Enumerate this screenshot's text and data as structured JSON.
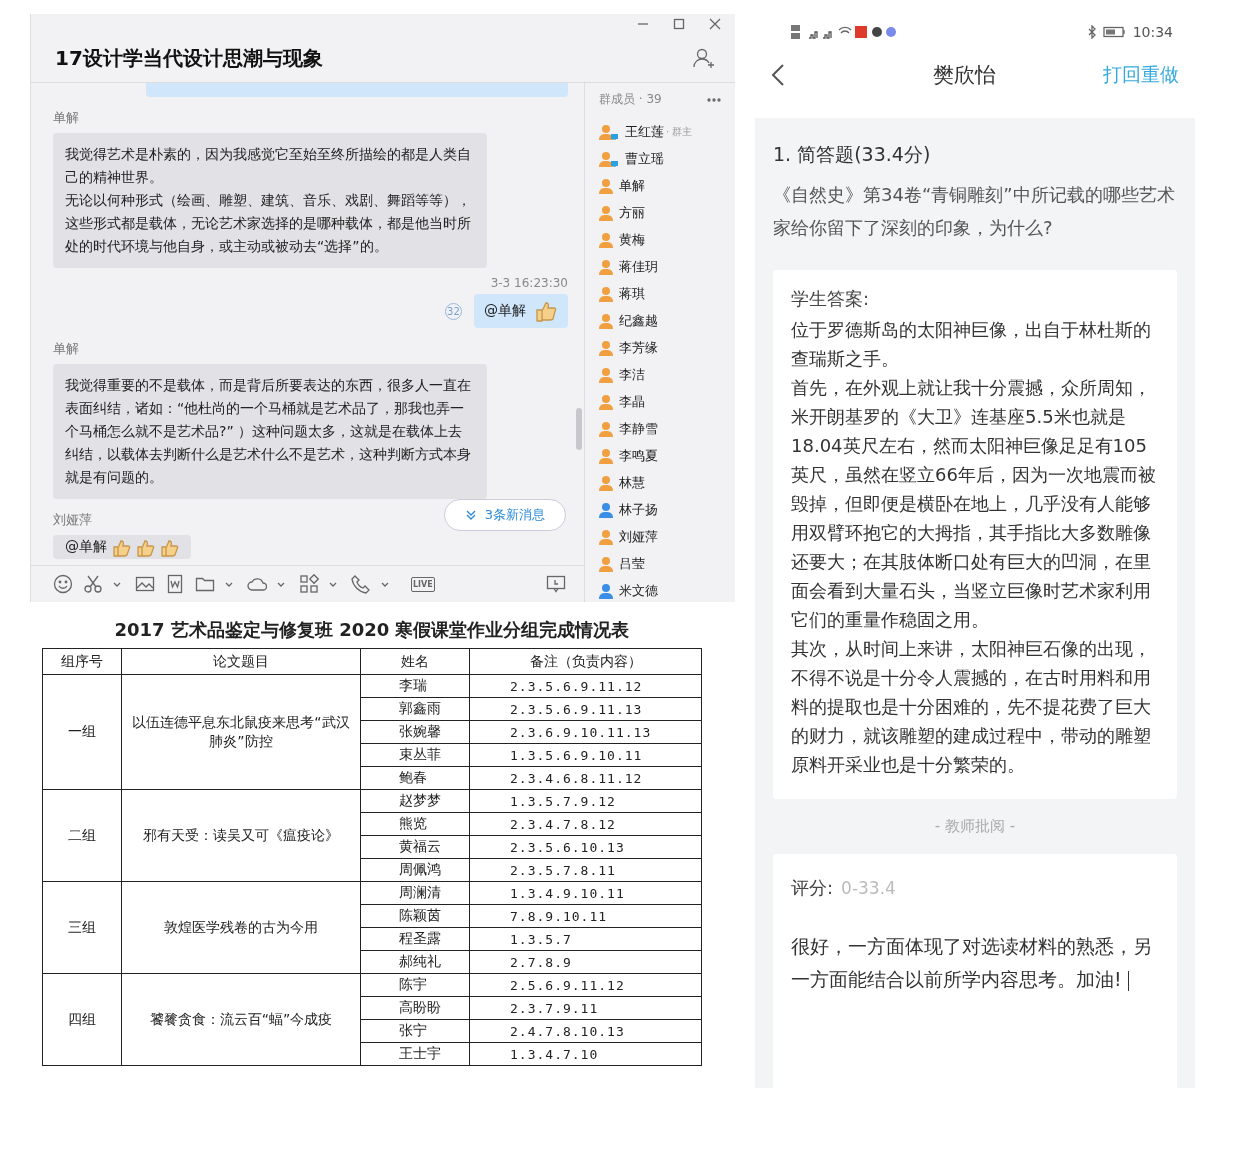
{
  "chat_window": {
    "title": "17设计学当代设计思潮与现象",
    "messages": [
      {
        "kind": "cut"
      },
      {
        "kind": "incoming",
        "sender": "单解",
        "paragraphs": [
          "我觉得艺术是朴素的，因为我感觉它至始至终所描绘的都是人类自己的精神世界。",
          "无论以何种形式（绘画、雕塑、建筑、音乐、戏剧、舞蹈等等），这些形式都是载体，无论艺术家选择的是哪种载体，都是他当时所处的时代环境与他自身，或主动或被动去“选择”的。"
        ]
      },
      {
        "kind": "outgoing",
        "time": "3-3 16:23:30",
        "read_count": "32",
        "text": "@单解"
      },
      {
        "kind": "incoming",
        "sender": "单解",
        "paragraphs": [
          "我觉得重要的不是载体，而是背后所要表达的东西，很多人一直在表面纠结，诸如：“他杜尚的一个马桶就是艺术品了，那我也弄一个马桶怎么就不是艺术品?” ）这种问题太多，这就是在载体上去纠结，以载体去判断什么是艺术什么不是艺术，这种判断方式本身就是有问题的。"
        ]
      },
      {
        "kind": "partial",
        "sender": "刘娅萍",
        "text": "@单解"
      }
    ],
    "new_messages": "3条新消息",
    "live_label": "LIVE",
    "members_header": "群成员 · 39",
    "members": [
      {
        "name": "王红莲",
        "role": "· 群主",
        "kind": "pc",
        "color": "#f0a040"
      },
      {
        "name": "曹立瑶",
        "kind": "pc",
        "color": "#f0a040"
      },
      {
        "name": "单解",
        "kind": "plain",
        "color": "#f0a040"
      },
      {
        "name": "方丽",
        "kind": "plain",
        "color": "#f0a040"
      },
      {
        "name": "黄梅",
        "kind": "plain",
        "color": "#f0a040"
      },
      {
        "name": "蒋佳玥",
        "kind": "plain",
        "color": "#f0a040"
      },
      {
        "name": "蒋琪",
        "kind": "plain",
        "color": "#f0a040"
      },
      {
        "name": "纪鑫越",
        "kind": "plain",
        "color": "#f0a040"
      },
      {
        "name": "李芳缘",
        "kind": "plain",
        "color": "#f0a040"
      },
      {
        "name": "李洁",
        "kind": "plain",
        "color": "#f0a040"
      },
      {
        "name": "李晶",
        "kind": "plain",
        "color": "#f0a040"
      },
      {
        "name": "李静雪",
        "kind": "plain",
        "color": "#f0a040"
      },
      {
        "name": "李鸣夏",
        "kind": "plain",
        "color": "#f0a040"
      },
      {
        "name": "林慧",
        "kind": "plain",
        "color": "#f0a040"
      },
      {
        "name": "林子扬",
        "kind": "plain",
        "color": "#3a8ee6"
      },
      {
        "name": "刘娅萍",
        "kind": "plain",
        "color": "#f0a040"
      },
      {
        "name": "吕莹",
        "kind": "plain",
        "color": "#f0a040"
      },
      {
        "name": "米文德",
        "kind": "plain",
        "color": "#3a8ee6"
      }
    ]
  },
  "table": {
    "title": "2017 艺术品鉴定与修复班 2020 寒假课堂作业分组完成情况表",
    "columns": [
      "组序号",
      "论文题目",
      "姓名",
      "备注（负责内容）"
    ],
    "groups": [
      {
        "label": "一组",
        "topic": "以伍连德平息东北鼠疫来思考“武汉肺炎”防控",
        "members": [
          {
            "name": "李瑞",
            "notes": "2.3.5.6.9.11.12"
          },
          {
            "name": "郭鑫雨",
            "notes": "2.3.5.6.9.11.13"
          },
          {
            "name": "张婉馨",
            "notes": "2.3.6.9.10.11.13"
          },
          {
            "name": "束丛菲",
            "notes": "1.3.5.6.9.10.11"
          },
          {
            "name": "鲍春",
            "notes": "2.3.4.6.8.11.12"
          }
        ]
      },
      {
        "label": "二组",
        "topic": "邪有天受：读吴又可《瘟疫论》",
        "members": [
          {
            "name": "赵梦梦",
            "notes": "1.3.5.7.9.12"
          },
          {
            "name": "熊览",
            "notes": "2.3.4.7.8.12"
          },
          {
            "name": "黄福云",
            "notes": "2.3.5.6.10.13"
          },
          {
            "name": "周佩鸿",
            "notes": "2.3.5.7.8.11"
          }
        ]
      },
      {
        "label": "三组",
        "topic": "敦煌医学残卷的古为今用",
        "members": [
          {
            "name": "周澜清",
            "notes": "1.3.4.9.10.11"
          },
          {
            "name": "陈颖茵",
            "notes": "7.8.9.10.11"
          },
          {
            "name": "程圣露",
            "notes": "1.3.5.7"
          },
          {
            "name": "郝纯礼",
            "notes": "2.7.8.9"
          }
        ]
      },
      {
        "label": "四组",
        "topic": "饕餮贪食：流云百“蝠”今成疫",
        "members": [
          {
            "name": "陈宇",
            "notes": "2.5.6.9.11.12"
          },
          {
            "name": "高盼盼",
            "notes": "2.3.7.9.11"
          },
          {
            "name": "张宁",
            "notes": "2.4.7.8.10.13"
          },
          {
            "name": "王士宇",
            "notes": "1.3.4.7.10"
          }
        ]
      }
    ]
  },
  "phone": {
    "time": "10:34",
    "title": "樊欣怡",
    "action": "打回重做",
    "question_heading": "1. 简答题(33.4分)",
    "question": "《自然史》第34卷“青铜雕刻”中所记载的哪些艺术家给你留下了深刻的印象，为什么?",
    "answer_label": "学生答案:",
    "answer": [
      "位于罗德斯岛的太阳神巨像，出自于林杜斯的查瑞斯之手。",
      "首先，在外观上就让我十分震撼，众所周知，米开朗基罗的《大卫》连基座5.5米也就是18.04英尺左右，然而太阳神巨像足足有105英尺，虽然在竖立66年后，因为一次地震而被毁掉，但即便是横卧在地上，几乎没有人能够用双臂环抱它的大拇指，其手指比大多数雕像还要大；在其肢体断口处有巨大的凹洞，在里面会看到大量石头，当竖立巨像时艺术家利用它们的重量作稳固之用。",
      "其次，从时间上来讲，太阳神巨石像的出现，不得不说是十分令人震撼的，在古时用料和用料的提取也是十分困难的，先不提花费了巨大的财力，就该雕塑的建成过程中，带动的雕塑原料开采业也是十分繁荣的。"
    ],
    "review_divider": "- 教师批阅 -",
    "score_label": "评分:",
    "score_placeholder": "0-33.4",
    "comment": "很好，一方面体现了对选读材料的熟悉，另一方面能结合以前所学内容思考。加油!"
  }
}
